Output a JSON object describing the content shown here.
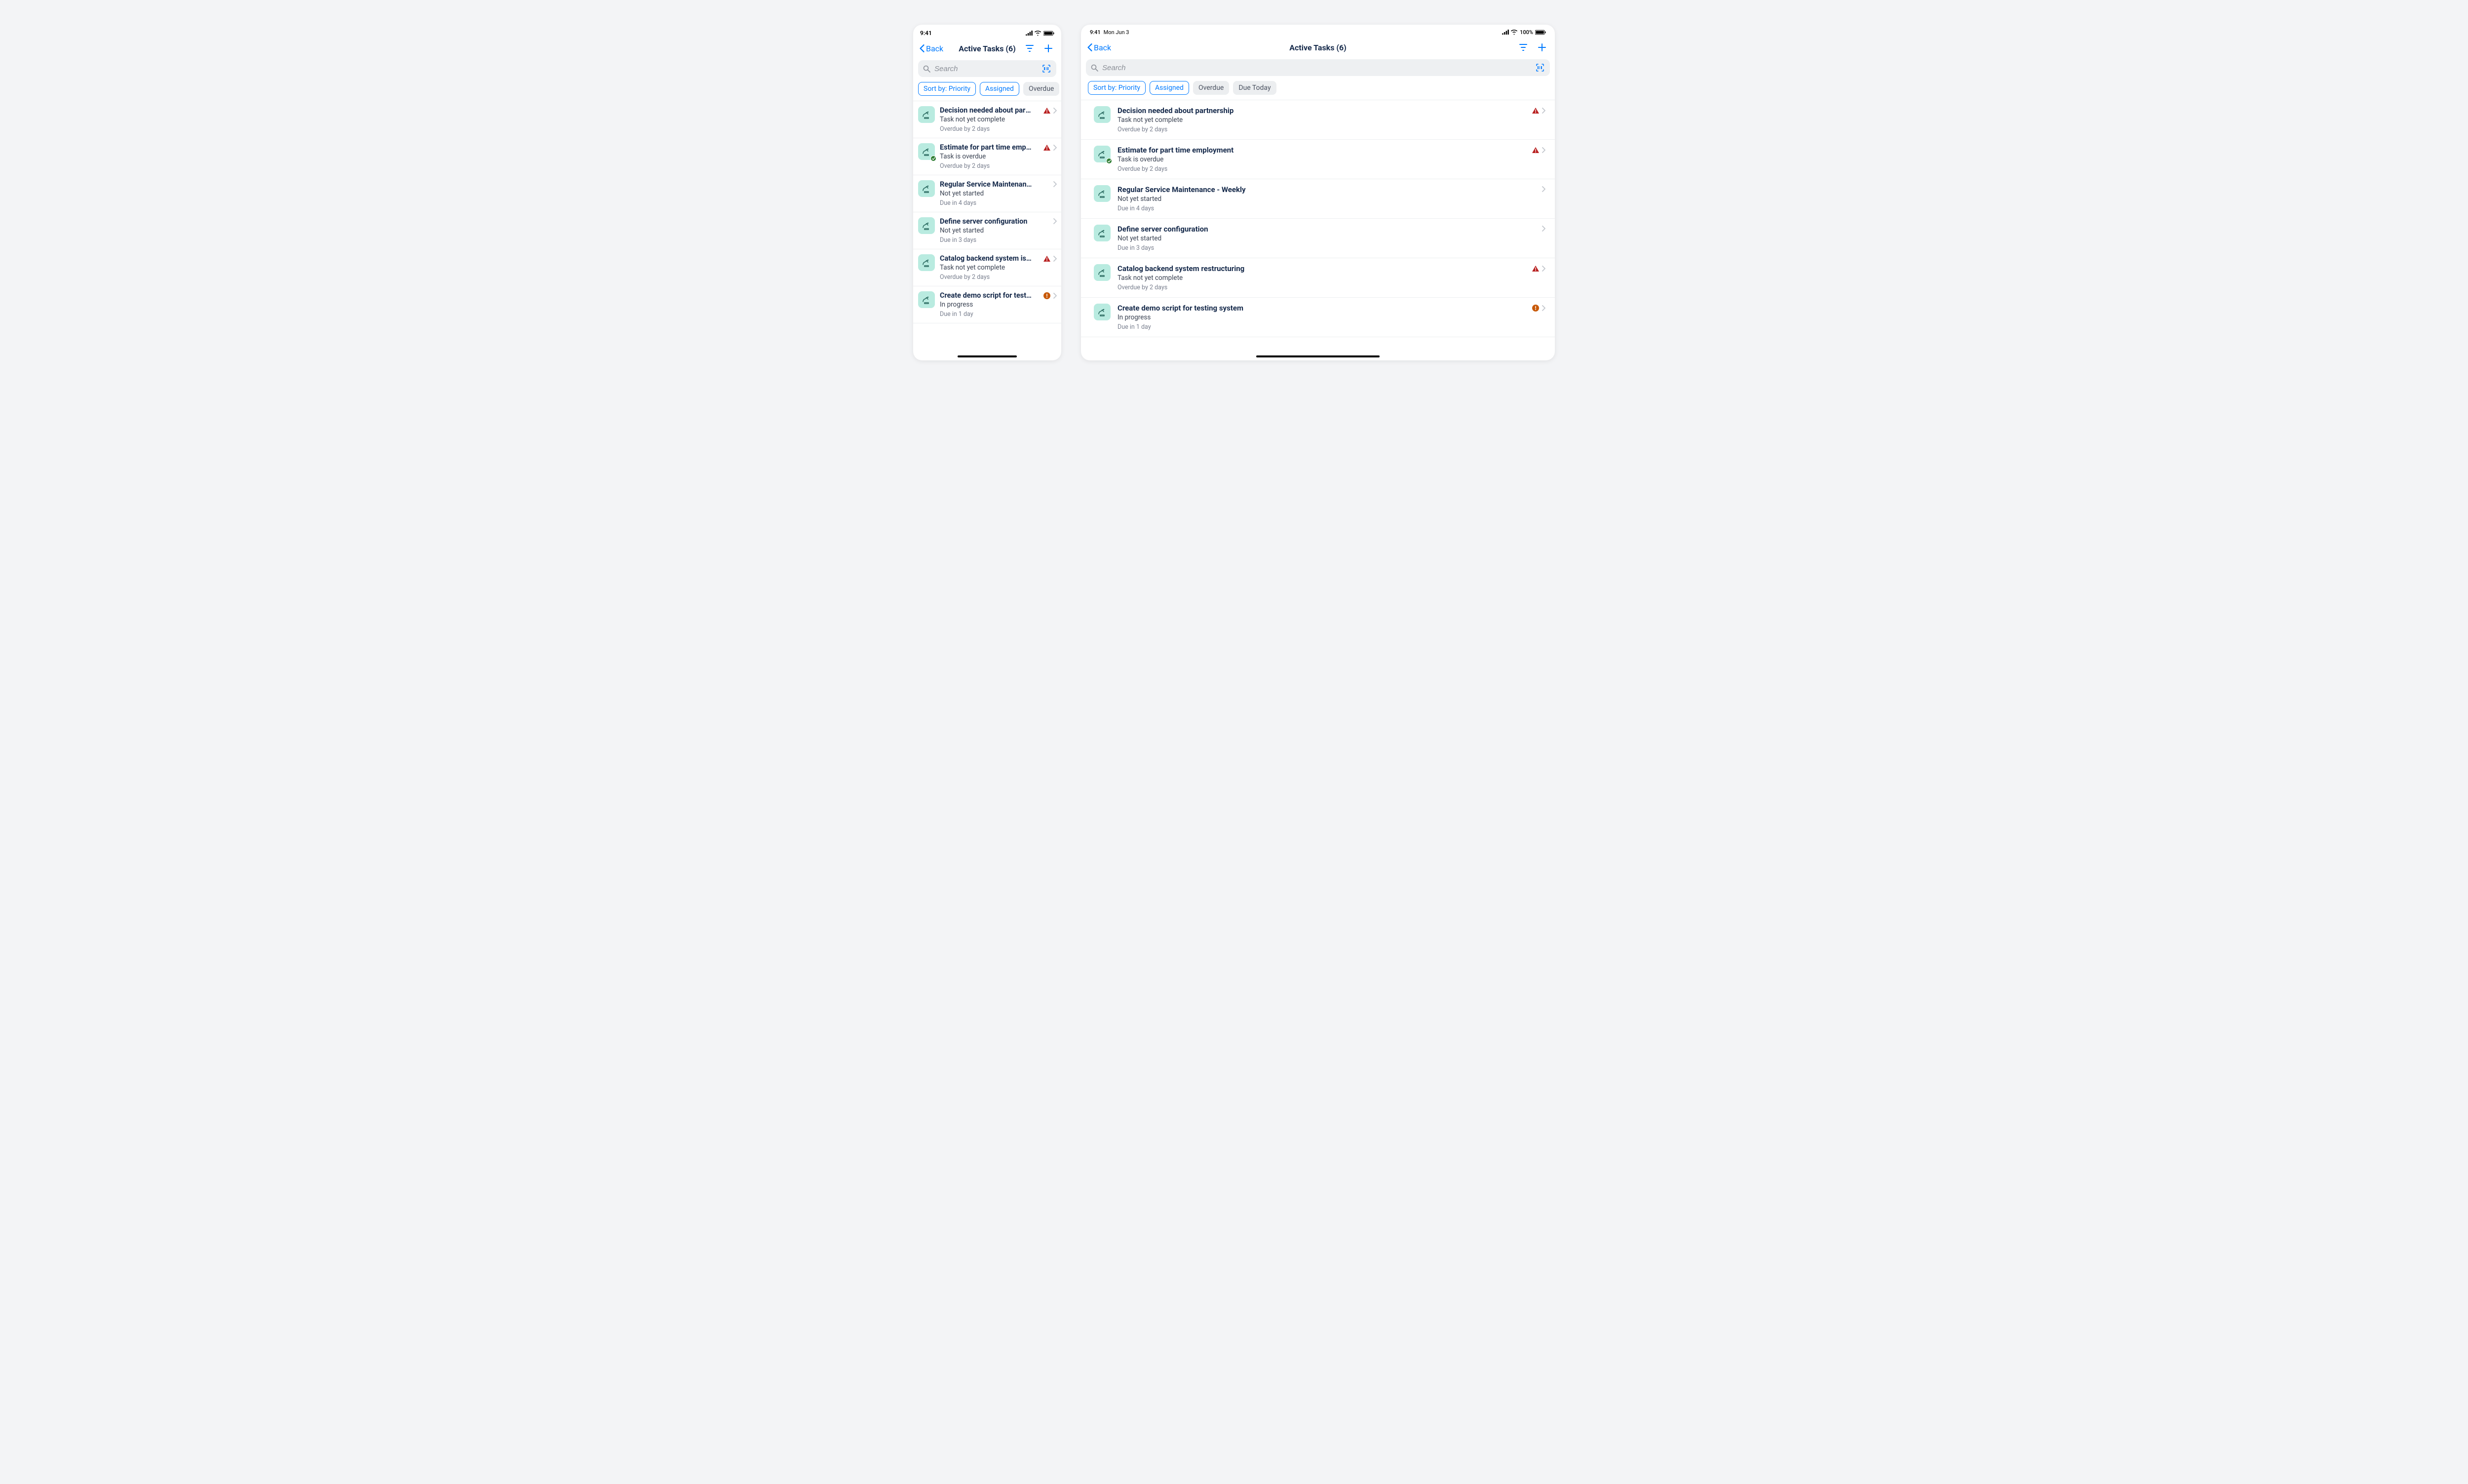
{
  "status": {
    "time": "9:41",
    "date": "Mon Jun 3",
    "battery_pct": "100%"
  },
  "nav": {
    "back": "Back",
    "title": "Active Tasks (6)"
  },
  "search": {
    "placeholder": "Search"
  },
  "chips": [
    {
      "label": "Sort by: Priority",
      "active": true
    },
    {
      "label": "Assigned",
      "active": true
    },
    {
      "label": "Overdue",
      "active": false
    },
    {
      "label": "Due Today",
      "active": false
    }
  ],
  "tasks_phone": [
    {
      "title": "Decision needed about partn…",
      "sub": "Task not yet complete",
      "meta": "Overdue by 2 days",
      "alert": "red",
      "badge": false
    },
    {
      "title": "Estimate for part time emplo…",
      "sub": "Task is overdue",
      "meta": "Overdue by 2 days",
      "alert": "red",
      "badge": true
    },
    {
      "title": "Regular Service Maintenanc…",
      "sub": "Not yet started",
      "meta": "Due in 4 days",
      "alert": null,
      "badge": false
    },
    {
      "title": "Define server configuration",
      "sub": "Not yet started",
      "meta": "Due in 3 days",
      "alert": null,
      "badge": false
    },
    {
      "title": "Catalog backend system is r…",
      "sub": "Task not yet complete",
      "meta": "Overdue by 2 days",
      "alert": "red",
      "badge": false
    },
    {
      "title": "Create demo script for testin…",
      "sub": "In progress",
      "meta": "Due in 1 day",
      "alert": "orange",
      "badge": false
    }
  ],
  "tasks_tablet": [
    {
      "title": "Decision needed about partnership",
      "sub": "Task not yet complete",
      "meta": "Overdue by 2 days",
      "alert": "red",
      "badge": false
    },
    {
      "title": "Estimate for part time employment",
      "sub": "Task is overdue",
      "meta": "Overdue by 2 days",
      "alert": "red",
      "badge": true
    },
    {
      "title": "Regular Service Maintenance - Weekly",
      "sub": "Not yet started",
      "meta": "Due in 4 days",
      "alert": null,
      "badge": false
    },
    {
      "title": "Define server configuration",
      "sub": "Not yet started",
      "meta": "Due in 3 days",
      "alert": null,
      "badge": false
    },
    {
      "title": "Catalog backend system restructuring",
      "sub": "Task not yet complete",
      "meta": "Overdue by 2 days",
      "alert": "red",
      "badge": false
    },
    {
      "title": "Create demo script for testing system",
      "sub": "In progress",
      "meta": "Due in 1 day",
      "alert": "orange",
      "badge": false
    }
  ]
}
